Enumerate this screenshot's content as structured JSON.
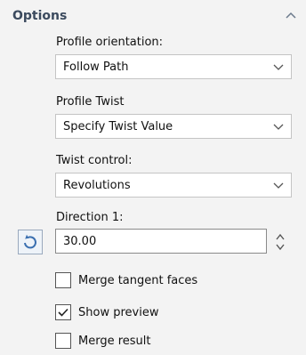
{
  "section": {
    "title": "Options"
  },
  "profile_orientation": {
    "label": "Profile orientation:",
    "value": "Follow Path"
  },
  "profile_twist": {
    "label": "Profile Twist",
    "value": "Specify Twist Value"
  },
  "twist_control": {
    "label": "Twist control:",
    "value": "Revolutions"
  },
  "direction1": {
    "label": "Direction 1:",
    "value": "30.00"
  },
  "checkboxes": [
    {
      "label": "Merge tangent faces",
      "checked": false
    },
    {
      "label": "Show preview",
      "checked": true
    },
    {
      "label": "Merge result",
      "checked": false
    }
  ],
  "colors": {
    "header_text": "#3b4a5e",
    "panel_bg": "#f3f3f3",
    "accent": "#2c6fb7"
  }
}
